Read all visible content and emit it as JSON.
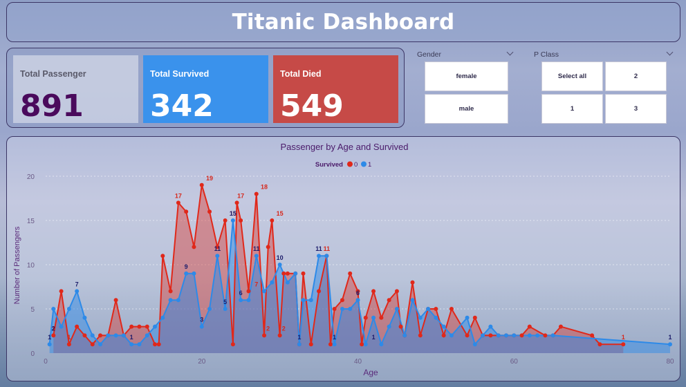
{
  "header": {
    "title": "Titanic Dashboard"
  },
  "kpis": {
    "total": {
      "label": "Total Passenger",
      "value": "891"
    },
    "survived": {
      "label": "Total Survived",
      "value": "342"
    },
    "died": {
      "label": "Total Died",
      "value": "549"
    }
  },
  "slicers": {
    "gender": {
      "title": "Gender",
      "options": [
        "female",
        "male"
      ]
    },
    "pclass": {
      "title": "P Class",
      "options": [
        "Select all",
        "2",
        "1",
        "3"
      ]
    }
  },
  "colors": {
    "died": "#e0281a",
    "survived": "#2d8ae8",
    "title": "#4a1a6a"
  },
  "chart_data": {
    "type": "area",
    "title": "Passenger by Age and Survived",
    "legend_title": "Survived",
    "legend_position": "top-center",
    "xlabel": "Age",
    "ylabel": "Number of Passengers",
    "xlim": [
      0,
      80
    ],
    "ylim": [
      0,
      20
    ],
    "xticks": [
      0,
      20,
      40,
      60,
      80
    ],
    "yticks": [
      0,
      5,
      10,
      15,
      20
    ],
    "grid": true,
    "series": [
      {
        "name": "0",
        "color": "#e0281a",
        "x": [
          1,
          2,
          3,
          4,
          5,
          6,
          7,
          8,
          9,
          10,
          11,
          12,
          13,
          14,
          14.5,
          15,
          16,
          17,
          18,
          19,
          20,
          21,
          22,
          23,
          24,
          24.5,
          25,
          26,
          27,
          28,
          28.5,
          29,
          30,
          30.5,
          31,
          32,
          32.5,
          33,
          34,
          35,
          36,
          36.5,
          37,
          38,
          39,
          40,
          40.5,
          41,
          42,
          43,
          44,
          45,
          45.5,
          46,
          47,
          48,
          49,
          50,
          51,
          52,
          54,
          55,
          56,
          57,
          58,
          59,
          60,
          61,
          62,
          64,
          65,
          66,
          70,
          71,
          74
        ],
        "y": [
          2,
          7,
          1,
          3,
          2,
          1,
          2,
          2,
          6,
          2,
          3,
          3,
          3,
          1,
          1,
          11,
          7,
          17,
          16,
          12,
          19,
          16,
          12,
          15,
          1,
          17,
          15,
          7,
          18,
          2,
          12,
          15,
          2,
          9,
          9,
          9,
          1,
          9,
          1,
          7,
          11,
          1,
          5,
          6,
          9,
          7,
          1,
          4,
          7,
          4,
          6,
          7,
          3,
          2,
          8,
          2,
          5,
          5,
          2,
          5,
          2,
          4,
          2,
          2,
          2,
          2,
          2,
          2,
          3,
          2,
          2,
          3,
          2,
          1,
          1
        ],
        "labels": [
          {
            "x": 1,
            "y": 2,
            "text": "1"
          },
          {
            "x": 3,
            "y": 1,
            "text": "1"
          },
          {
            "x": 17,
            "y": 17,
            "text": "17"
          },
          {
            "x": 21,
            "y": 19,
            "text": "19"
          },
          {
            "x": 24,
            "y": 15,
            "text": "15"
          },
          {
            "x": 25,
            "y": 17,
            "text": "17"
          },
          {
            "x": 27,
            "y": 7,
            "text": "7"
          },
          {
            "x": 28,
            "y": 18,
            "text": "18"
          },
          {
            "x": 28.5,
            "y": 2,
            "text": "2"
          },
          {
            "x": 30,
            "y": 15,
            "text": "15"
          },
          {
            "x": 30.5,
            "y": 2,
            "text": "2"
          },
          {
            "x": 36,
            "y": 11,
            "text": "11"
          },
          {
            "x": 74,
            "y": 1,
            "text": "1"
          }
        ]
      },
      {
        "name": "1",
        "color": "#2d8ae8",
        "x": [
          0.5,
          1,
          2,
          3,
          4,
          5,
          6,
          7,
          8,
          9,
          10,
          11,
          12,
          13,
          14,
          15,
          16,
          17,
          18,
          19,
          20,
          21,
          22,
          23,
          24,
          25,
          26,
          27,
          28,
          29,
          30,
          31,
          32,
          32.5,
          33,
          34,
          35,
          36,
          37,
          38,
          39,
          40,
          41,
          42,
          43,
          44,
          45,
          46,
          47,
          48,
          49,
          50,
          51,
          52,
          54,
          55,
          56,
          57,
          58,
          59,
          60,
          62,
          63,
          65,
          80
        ],
        "y": [
          1,
          5,
          3,
          5,
          7,
          4,
          2,
          1,
          2,
          2,
          2,
          1,
          1,
          2,
          3,
          4,
          6,
          6,
          9,
          9,
          3,
          5,
          11,
          5,
          15,
          6,
          6,
          11,
          7,
          8,
          10,
          8,
          9,
          1,
          6,
          6,
          11,
          11,
          1,
          5,
          5,
          6,
          1,
          4,
          1,
          3,
          5,
          2,
          6,
          4,
          5,
          4,
          3,
          2,
          4,
          1,
          2,
          3,
          2,
          2,
          2,
          2,
          2,
          2,
          1
        ],
        "labels": [
          {
            "x": 0.5,
            "y": 1,
            "text": "1"
          },
          {
            "x": 1,
            "y": 2,
            "text": "2"
          },
          {
            "x": 4,
            "y": 7,
            "text": "7"
          },
          {
            "x": 11,
            "y": 1,
            "text": "1"
          },
          {
            "x": 18,
            "y": 9,
            "text": "9"
          },
          {
            "x": 20,
            "y": 3,
            "text": "3"
          },
          {
            "x": 22,
            "y": 11,
            "text": "11"
          },
          {
            "x": 23,
            "y": 5,
            "text": "5"
          },
          {
            "x": 24,
            "y": 15,
            "text": "15"
          },
          {
            "x": 25,
            "y": 6,
            "text": "6"
          },
          {
            "x": 27,
            "y": 11,
            "text": "11"
          },
          {
            "x": 30,
            "y": 10,
            "text": "10"
          },
          {
            "x": 32.5,
            "y": 1,
            "text": "1"
          },
          {
            "x": 35,
            "y": 11,
            "text": "11"
          },
          {
            "x": 37,
            "y": 1,
            "text": "1"
          },
          {
            "x": 40,
            "y": 6,
            "text": "6"
          },
          {
            "x": 42,
            "y": 1,
            "text": "1"
          },
          {
            "x": 80,
            "y": 1,
            "text": "1"
          }
        ]
      }
    ]
  }
}
